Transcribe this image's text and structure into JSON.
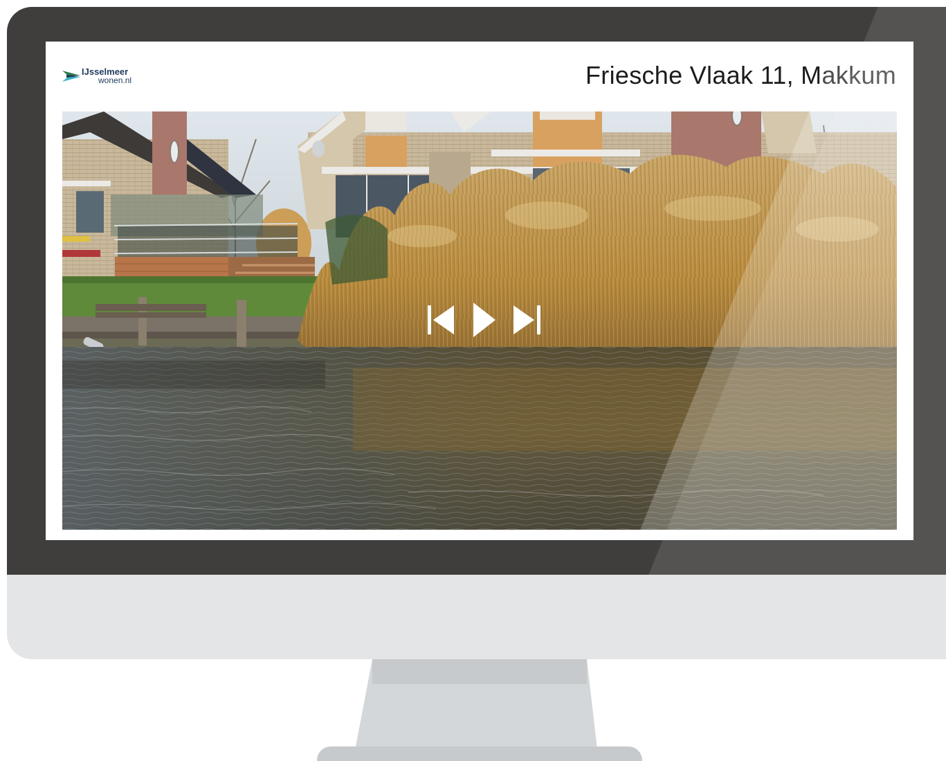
{
  "site": {
    "logo_name": "IJsselmeer",
    "logo_domain": "wonen.nl"
  },
  "listing": {
    "address": "Friesche Vlaak 11, Makkum"
  },
  "slideshow": {
    "controls": [
      "previous-icon",
      "play-icon",
      "next-icon"
    ]
  },
  "colors": {
    "bezel": "#3f3e3c",
    "chin": "#e4e5e7",
    "stand": "#d4d7d9",
    "brand_navy": "#1f3a5c",
    "brand_teal": "#3bb4c4",
    "brand_green": "#2f7a4f"
  }
}
